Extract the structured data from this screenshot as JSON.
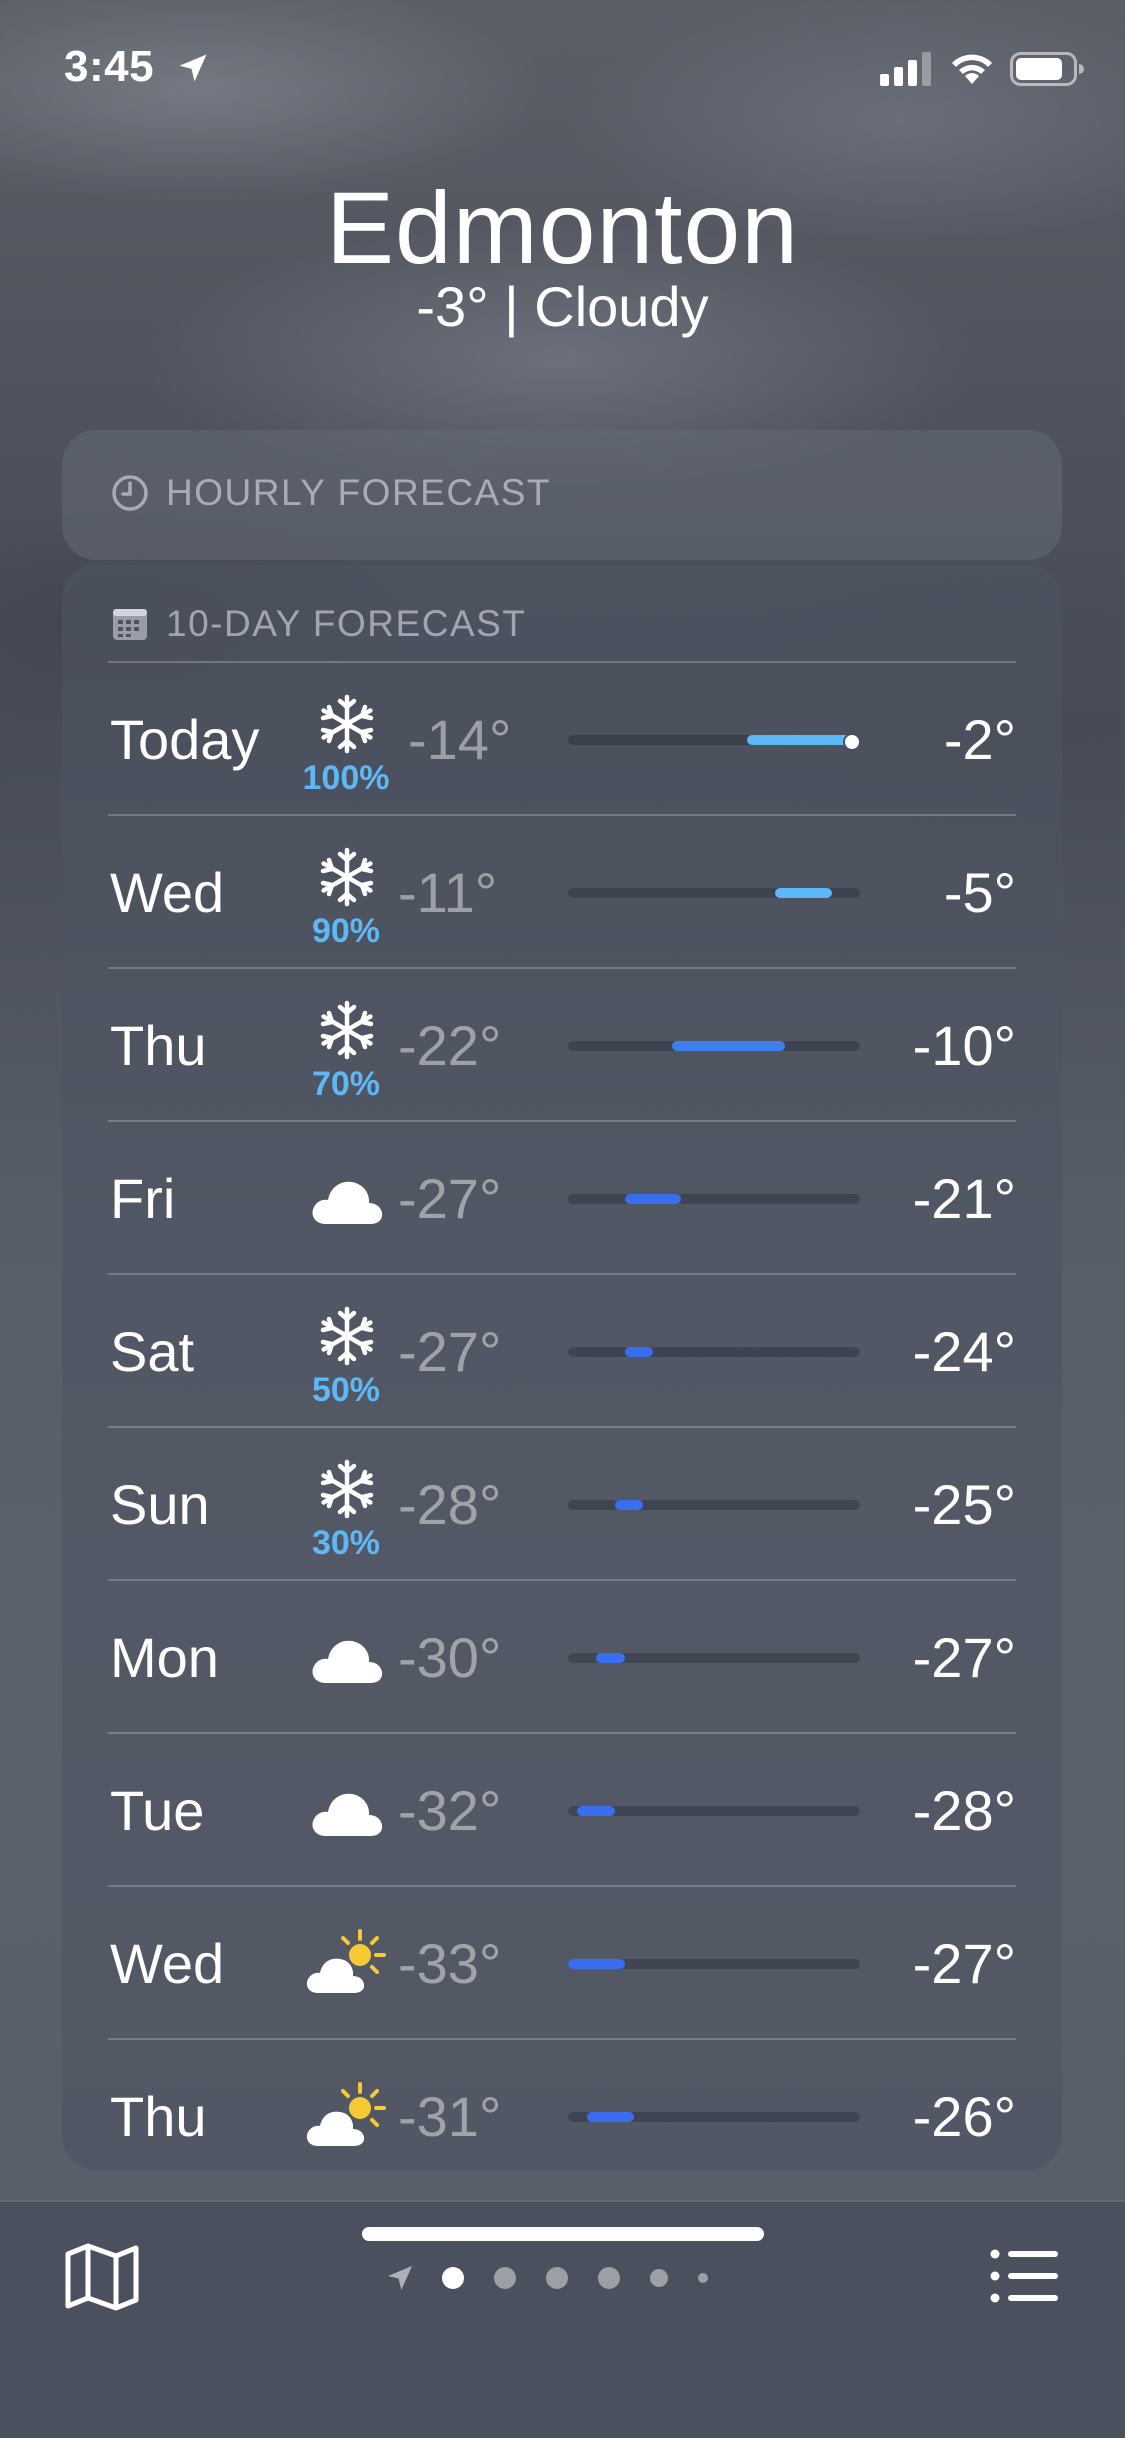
{
  "status": {
    "time": "3:45"
  },
  "header": {
    "city": "Edmonton",
    "summary": "-3°  |  Cloudy"
  },
  "hourly": {
    "title": "HOURLY FORECAST"
  },
  "daily": {
    "title": "10-DAY FORECAST",
    "scale": {
      "min": -33,
      "max": -2
    },
    "days": [
      {
        "day": "Today",
        "icon": "snowflake-icon",
        "precip": "100%",
        "low": "-14°",
        "high": "-2°",
        "low_val": -14,
        "high_val": -2,
        "color": "#5eb8f5",
        "current": -3
      },
      {
        "day": "Wed",
        "icon": "snowflake-icon",
        "precip": "90%",
        "low": "-11°",
        "high": "-5°",
        "low_val": -11,
        "high_val": -5,
        "color": "#5eb8f5"
      },
      {
        "day": "Thu",
        "icon": "snowflake-icon",
        "precip": "70%",
        "low": "-22°",
        "high": "-10°",
        "low_val": -22,
        "high_val": -10,
        "color": "#3d7ff0"
      },
      {
        "day": "Fri",
        "icon": "cloud-icon",
        "precip": "",
        "low": "-27°",
        "high": "-21°",
        "low_val": -27,
        "high_val": -21,
        "color": "#3a6ef0"
      },
      {
        "day": "Sat",
        "icon": "snowflake-icon",
        "precip": "50%",
        "low": "-27°",
        "high": "-24°",
        "low_val": -27,
        "high_val": -24,
        "color": "#3a6ef0"
      },
      {
        "day": "Sun",
        "icon": "snowflake-icon",
        "precip": "30%",
        "low": "-28°",
        "high": "-25°",
        "low_val": -28,
        "high_val": -25,
        "color": "#3a6ef0"
      },
      {
        "day": "Mon",
        "icon": "cloud-icon",
        "precip": "",
        "low": "-30°",
        "high": "-27°",
        "low_val": -30,
        "high_val": -27,
        "color": "#3a6ef0"
      },
      {
        "day": "Tue",
        "icon": "cloud-icon",
        "precip": "",
        "low": "-32°",
        "high": "-28°",
        "low_val": -32,
        "high_val": -28,
        "color": "#3a6ef0"
      },
      {
        "day": "Wed",
        "icon": "cloud-sun-icon",
        "precip": "",
        "low": "-33°",
        "high": "-27°",
        "low_val": -33,
        "high_val": -27,
        "color": "#3a6ef0"
      },
      {
        "day": "Thu",
        "icon": "cloud-sun-icon",
        "precip": "",
        "low": "-31°",
        "high": "-26°",
        "low_val": -31,
        "high_val": -26,
        "color": "#3a6ef0"
      }
    ]
  },
  "toolbar": {
    "pages": [
      {
        "icon": "location-arrow-icon"
      },
      {
        "icon": "page-dot-current"
      },
      {
        "icon": "page-dot"
      },
      {
        "icon": "page-dot"
      },
      {
        "icon": "page-dot"
      },
      {
        "icon": "page-dot-small"
      },
      {
        "icon": "page-dot-tiny"
      }
    ]
  }
}
